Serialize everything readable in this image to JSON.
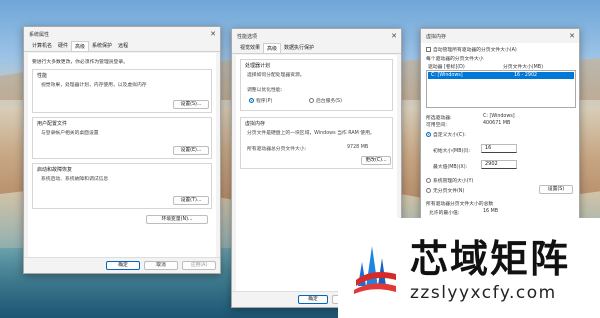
{
  "win1": {
    "title": "系统属性",
    "tabs": [
      "计算机名",
      "硬件",
      "高级",
      "系统保护",
      "远程"
    ],
    "notice": "要进行大多数更改，你必须作为管理员登录。",
    "perf": {
      "label": "性能",
      "desc": "视觉效果，处理器计划，内存使用，以及虚拟内存",
      "button": "设置(S)..."
    },
    "profile": {
      "label": "用户配置文件",
      "desc": "与登录帐户相关的桌面设置",
      "button": "设置(E)..."
    },
    "startup": {
      "label": "启动和故障恢复",
      "desc": "系统启动、系统故障和调试信息",
      "button": "设置(T)..."
    },
    "env_button": "环境变量(N)...",
    "ok": "确定",
    "cancel": "取消",
    "apply": "应用(A)"
  },
  "win2": {
    "title": "性能选项",
    "tabs": [
      "视觉效果",
      "高级",
      "数据执行保护"
    ],
    "sched": {
      "label": "处理器计划",
      "desc": "选择如何分配处理器资源。",
      "adjust": "调整以优化性能:",
      "opt1": "程序(P)",
      "opt2": "后台服务(S)"
    },
    "vm": {
      "label": "虚拟内存",
      "desc": "分页文件是硬盘上的一块区域，Windows 当作 RAM 使用。",
      "total_label": "所有驱动器总分页文件大小:",
      "total_value": "9728 MB",
      "button": "更改(C)..."
    },
    "ok": "确定",
    "cancel": "取消"
  },
  "win3": {
    "title": "虚拟内存",
    "auto_label": "自动管理所有驱动器的分页文件大小(A)",
    "each_label": "每个驱动器的分页文件大小",
    "col_drive": "驱动器 [卷标](D)",
    "col_size": "分页文件大小(MB)",
    "row_drive": "C:      [Windows]",
    "row_size": "16 - 2902",
    "sel_drive_label": "所选驱动器:",
    "sel_drive_value": "C: [Windows]",
    "space_label": "可用空间:",
    "space_value": "400671 MB",
    "custom_label": "自定义大小(C):",
    "initial_label": "初始大小(MB)(I):",
    "initial_value": "16",
    "max_label": "最大值(MB)(X):",
    "max_value": "2902",
    "sys_label": "系统管理的大小(Y)",
    "none_label": "无分页文件(N)",
    "set_button": "设置(S)",
    "total_section": "所有驱动器分页文件大小的总数",
    "min_label": "允许的最小值:",
    "min_value": "16 MB"
  },
  "brand": {
    "name": "芯域矩阵",
    "url": "zzslyyxcfy.com"
  }
}
